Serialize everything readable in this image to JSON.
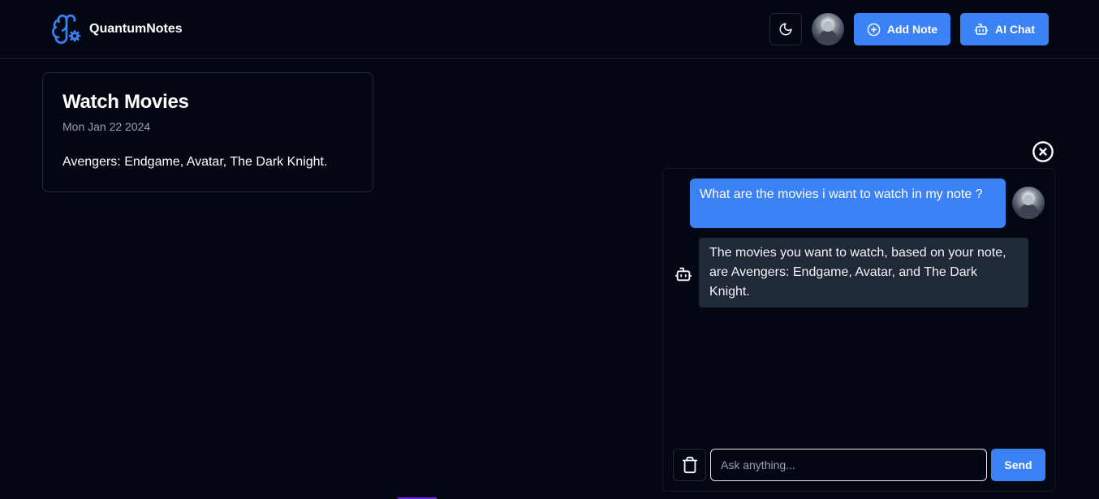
{
  "header": {
    "brand": "QuantumNotes",
    "buttons": {
      "add_note": "Add Note",
      "ai_chat": "AI Chat"
    },
    "icons": {
      "logo": "brain-gear-icon",
      "theme": "moon-icon",
      "add": "plus-circle-icon",
      "ai": "bot-icon"
    }
  },
  "notes": [
    {
      "title": "Watch Movies",
      "date": "Mon Jan 22 2024",
      "content": "Avengers: Endgame, Avatar, The Dark Knight."
    }
  ],
  "chat": {
    "messages": [
      {
        "role": "user",
        "text": "What are the movies i want to watch in my note ?"
      },
      {
        "role": "assistant",
        "text": "The movies you want to watch, based on your note, are Avengers: Endgame, Avatar, and The Dark Knight."
      }
    ],
    "input": {
      "placeholder": "Ask anything...",
      "value": ""
    },
    "send_label": "Send"
  },
  "colors": {
    "background": "#030712",
    "accent": "#3b82f6",
    "bot_bubble": "#1f2937",
    "border": "#1f2937"
  }
}
